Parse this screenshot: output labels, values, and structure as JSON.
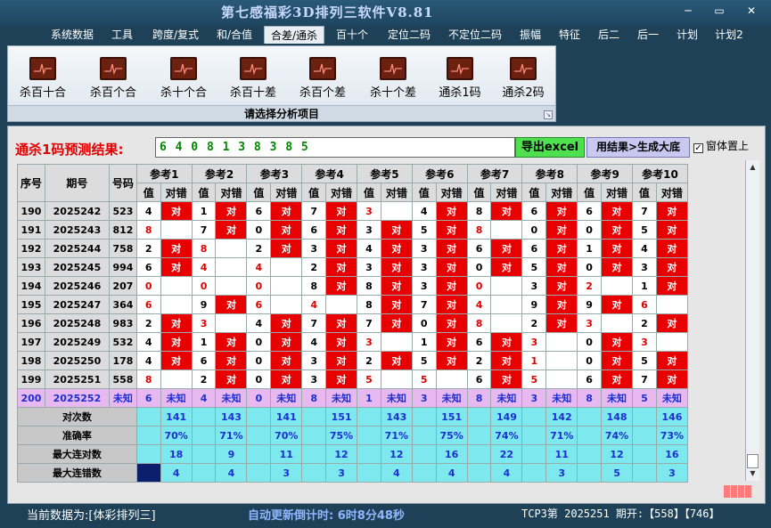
{
  "title": "第七感福彩3D排列三软件V8.81",
  "window_buttons": [
    "─",
    "▭",
    "✕"
  ],
  "menu": [
    "系统数据",
    "工具",
    "跨度/复式",
    "和/合值",
    "合差/通杀",
    "百十个",
    "定位二码",
    "不定位二码",
    "振幅",
    "特征",
    "后二",
    "后一",
    "计划",
    "计划2"
  ],
  "ribbon": {
    "buttons": [
      "杀百十合",
      "杀百个合",
      "杀十个合",
      "杀百十差",
      "杀百个差",
      "杀十个差",
      "通杀1码",
      "通杀2码"
    ],
    "footer": "请选择分析项目"
  },
  "prediction": {
    "label": "通杀1码预测结果:",
    "value": "6 4 0 8 1 3 8 3 8 5",
    "export_label": "导出excel",
    "generate_label": "用结果>生成大底",
    "topmost_label": "窗体置上",
    "topmost_checked": "✓"
  },
  "table": {
    "headers": {
      "seq": "序号",
      "period": "期号",
      "number": "号码",
      "value": "值",
      "right_wrong": "对错"
    },
    "refs": [
      "参考1",
      "参考2",
      "参考3",
      "参考4",
      "参考5",
      "参考6",
      "参考7",
      "参考8",
      "参考9",
      "参考10"
    ],
    "rows": [
      {
        "seq": "190",
        "period": "2025242",
        "number": "523",
        "v": [
          "4",
          "1",
          "6",
          "7",
          "3",
          "4",
          "8",
          "6",
          "6",
          "7"
        ],
        "m": [
          1,
          1,
          1,
          1,
          0,
          1,
          1,
          1,
          1,
          1
        ]
      },
      {
        "seq": "191",
        "period": "2025243",
        "number": "812",
        "v": [
          "8",
          "7",
          "0",
          "6",
          "3",
          "5",
          "8",
          "0",
          "0",
          "5"
        ],
        "m": [
          0,
          1,
          1,
          1,
          1,
          1,
          0,
          1,
          1,
          1
        ]
      },
      {
        "seq": "192",
        "period": "2025244",
        "number": "758",
        "v": [
          "2",
          "8",
          "2",
          "3",
          "4",
          "3",
          "6",
          "6",
          "1",
          "4"
        ],
        "m": [
          1,
          0,
          1,
          1,
          1,
          1,
          1,
          1,
          1,
          1
        ]
      },
      {
        "seq": "193",
        "period": "2025245",
        "number": "994",
        "v": [
          "6",
          "4",
          "4",
          "2",
          "3",
          "3",
          "0",
          "5",
          "0",
          "3"
        ],
        "m": [
          1,
          0,
          0,
          1,
          1,
          1,
          1,
          1,
          1,
          1
        ]
      },
      {
        "seq": "194",
        "period": "2025246",
        "number": "207",
        "v": [
          "0",
          "0",
          "0",
          "8",
          "8",
          "3",
          "0",
          "3",
          "2",
          "1"
        ],
        "m": [
          0,
          0,
          0,
          1,
          1,
          1,
          0,
          1,
          0,
          1
        ]
      },
      {
        "seq": "195",
        "period": "2025247",
        "number": "364",
        "v": [
          "6",
          "9",
          "6",
          "4",
          "8",
          "7",
          "4",
          "9",
          "9",
          "6"
        ],
        "m": [
          0,
          1,
          0,
          0,
          1,
          1,
          0,
          1,
          1,
          0
        ]
      },
      {
        "seq": "196",
        "period": "2025248",
        "number": "983",
        "v": [
          "2",
          "3",
          "4",
          "7",
          "7",
          "0",
          "8",
          "2",
          "3",
          "2"
        ],
        "m": [
          1,
          0,
          1,
          1,
          1,
          1,
          0,
          1,
          0,
          1
        ]
      },
      {
        "seq": "197",
        "period": "2025249",
        "number": "532",
        "v": [
          "4",
          "1",
          "0",
          "4",
          "3",
          "1",
          "6",
          "3",
          "0",
          "3"
        ],
        "m": [
          1,
          1,
          1,
          1,
          0,
          1,
          1,
          0,
          1,
          0
        ]
      },
      {
        "seq": "198",
        "period": "2025250",
        "number": "178",
        "v": [
          "4",
          "6",
          "0",
          "3",
          "2",
          "5",
          "2",
          "1",
          "0",
          "5"
        ],
        "m": [
          1,
          1,
          1,
          1,
          1,
          1,
          1,
          0,
          1,
          1
        ]
      },
      {
        "seq": "199",
        "period": "2025251",
        "number": "558",
        "v": [
          "8",
          "2",
          "0",
          "3",
          "5",
          "5",
          "6",
          "5",
          "6",
          "7"
        ],
        "m": [
          0,
          1,
          1,
          1,
          0,
          0,
          1,
          0,
          1,
          1
        ]
      }
    ],
    "unknown_row": {
      "seq": "200",
      "period": "2025252",
      "number": "未知",
      "v": [
        "6",
        "4",
        "0",
        "8",
        "1",
        "3",
        "8",
        "3",
        "8",
        "5"
      ],
      "mark": "未知"
    },
    "mark_text": "对",
    "stats": [
      {
        "label": "对次数",
        "values": [
          "141",
          "143",
          "141",
          "151",
          "143",
          "151",
          "149",
          "142",
          "148",
          "146"
        ]
      },
      {
        "label": "准确率",
        "values": [
          "70%",
          "71%",
          "70%",
          "75%",
          "71%",
          "75%",
          "74%",
          "71%",
          "74%",
          "73%"
        ]
      },
      {
        "label": "最大连对数",
        "values": [
          "18",
          "9",
          "11",
          "12",
          "12",
          "16",
          "22",
          "11",
          "12",
          "16"
        ]
      },
      {
        "label": "最大连错数",
        "values": [
          "4",
          "4",
          "3",
          "3",
          "4",
          "4",
          "4",
          "3",
          "5",
          "3"
        ]
      }
    ]
  },
  "status": {
    "data_source": "当前数据为:[体彩排列三]",
    "countdown": "自动更新倒计时: 6时8分48秒",
    "draw": "TCP3第 2025251 期开:【558】【746】"
  },
  "colors": {
    "mark_red": "#e80000",
    "stat_cyan": "#7de8ee",
    "unknown_pink": "#e8b8f0",
    "export_green": "#4fe04f"
  }
}
